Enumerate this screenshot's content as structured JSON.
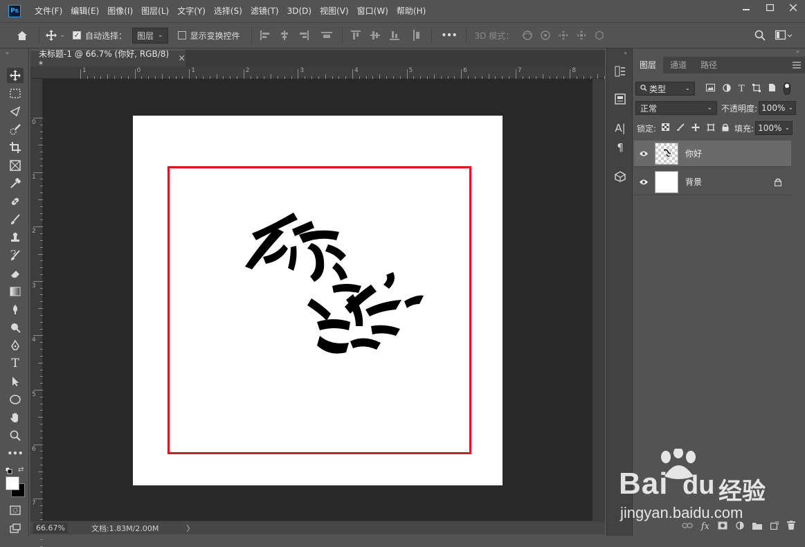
{
  "app": {
    "logo_text": "Ps"
  },
  "menu": [
    "文件(F)",
    "编辑(E)",
    "图像(I)",
    "图层(L)",
    "文字(Y)",
    "选择(S)",
    "滤镜(T)",
    "3D(D)",
    "视图(V)",
    "窗口(W)",
    "帮助(H)"
  ],
  "options_bar": {
    "auto_select_label": "自动选择：",
    "auto_select_target": "图层",
    "show_transform_label": "显示变换控件",
    "more": "•••",
    "mode_3d_label": "3D 模式："
  },
  "document": {
    "tab_title": "未标题-1 @ 66.7% (你好, RGB/8) *",
    "close_glyph": "×",
    "canvas_text": "你好"
  },
  "rulers": {
    "top": [
      "1",
      "0",
      "1",
      "2",
      "3",
      "4",
      "5",
      "6",
      "7",
      "8"
    ],
    "left": [
      "0",
      "1",
      "2",
      "3",
      "4",
      "5",
      "6",
      "7"
    ]
  },
  "status": {
    "zoom": "66.67%",
    "doc_info": "文档:1.83M/2.00M",
    "arrow": "〉"
  },
  "layers_panel": {
    "tabs": [
      "图层",
      "通道",
      "路径"
    ],
    "filter_label": "类型",
    "blend_mode": "正常",
    "opacity_label": "不透明度:",
    "opacity_value": "100%",
    "lock_label": "锁定:",
    "fill_label": "填充:",
    "fill_value": "100%",
    "layers": [
      {
        "name": "你好",
        "selected": true
      },
      {
        "name": "背景",
        "selected": false
      }
    ]
  },
  "watermark": {
    "brand": "Bai",
    "brand2": "经验",
    "url": "jingyan.baidu.com"
  },
  "colors": {
    "accent_red": "#e8141c",
    "ps_blue": "#31a8ff"
  }
}
